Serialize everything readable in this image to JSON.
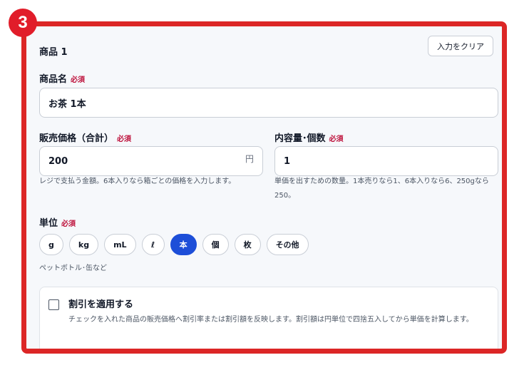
{
  "step_badge": "3",
  "section": {
    "title": "商品 1",
    "clear_button": "入力をクリア"
  },
  "product_name": {
    "label": "商品名",
    "required": "必須",
    "value": "お茶 1本"
  },
  "price": {
    "label": "販売価格（合計）",
    "required": "必須",
    "value": "200",
    "unit": "円",
    "help": "レジで支払う金額。6本入りなら箱ごとの価格を入力します。"
  },
  "quantity": {
    "label": "内容量･個数",
    "required": "必須",
    "value": "1",
    "help": "単価を出すための数量。1本売りなら1、6本入りなら6、250gなら250。"
  },
  "unit": {
    "label": "単位",
    "required": "必須",
    "options": [
      "g",
      "kg",
      "mL",
      "ℓ",
      "本",
      "個",
      "枚",
      "その他"
    ],
    "selected": "本",
    "hint": "ペットボトル･缶など"
  },
  "discount": {
    "checked": false,
    "title": "割引を適用する",
    "description": "チェックを入れた商品の販売価格へ割引率または割引額を反映します。割引額は円単位で四捨五入してから単価を計算します。"
  },
  "colors": {
    "frame": "#dc2626",
    "badge": "#e11d2a",
    "required": "#be123c",
    "selected_chip": "#1d4ed8"
  }
}
